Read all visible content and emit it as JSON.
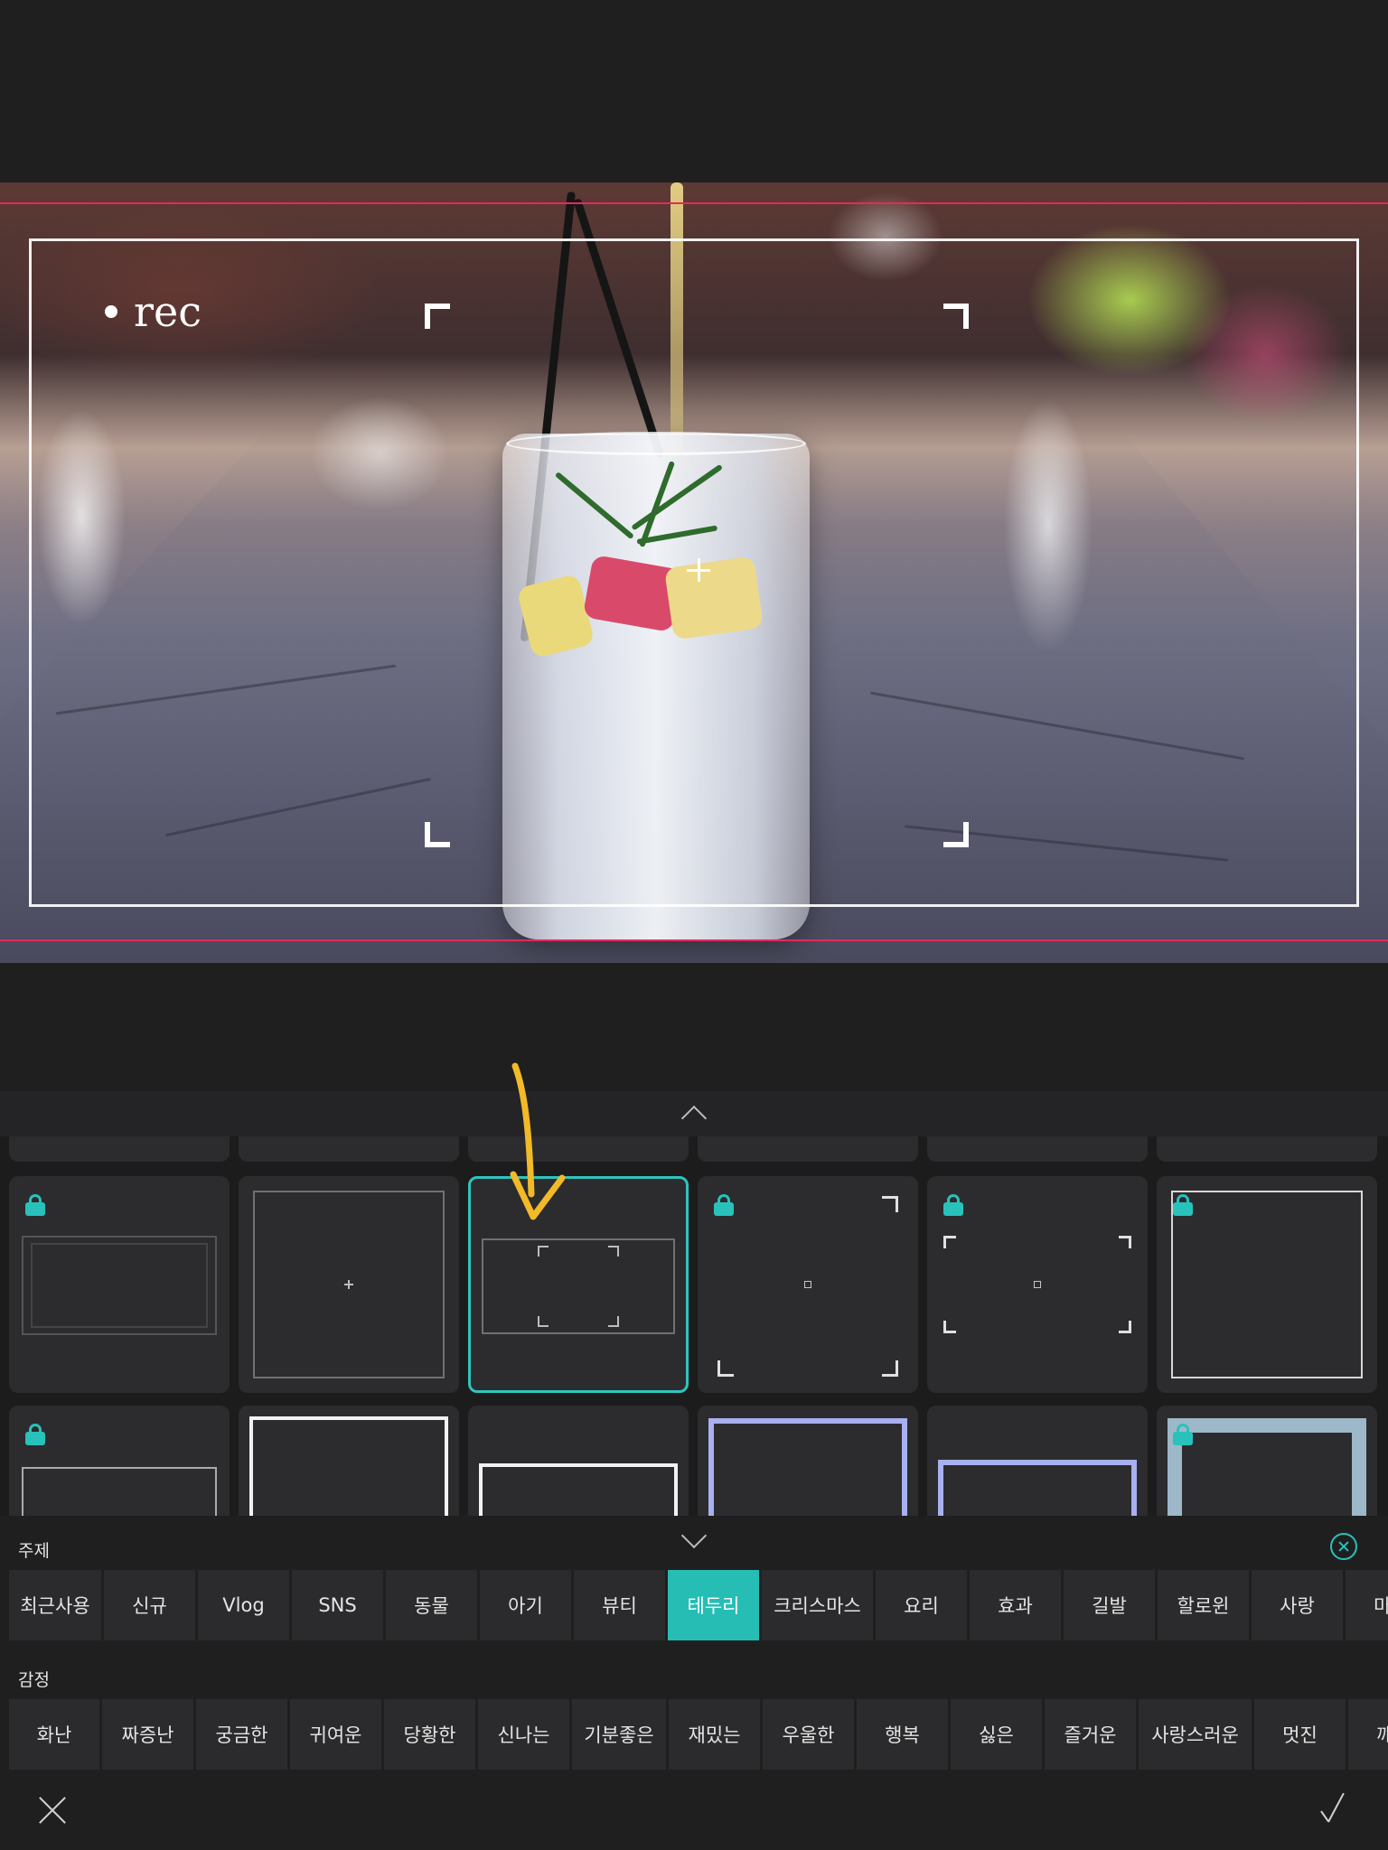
{
  "preview": {
    "overlay_text": "rec",
    "guide_color": "#e8285a"
  },
  "panel": {
    "accent_color": "#26bdb5",
    "selected_template_index": 8,
    "subject_label": "주제",
    "emotion_label": "감정",
    "subject_categories": [
      "최근사용",
      "신규",
      "Vlog",
      "SNS",
      "동물",
      "아기",
      "뷰티",
      "테두리",
      "크리스마스",
      "요리",
      "효과",
      "길발",
      "할로윈",
      "사랑",
      "마블"
    ],
    "active_subject": "테두리",
    "emotion_categories": [
      "화난",
      "짜증난",
      "궁금한",
      "귀여운",
      "당황한",
      "신나는",
      "기분좋은",
      "재밌는",
      "우울한",
      "행복",
      "싫은",
      "즐거운",
      "사랑스러운",
      "멋진",
      "깨끗"
    ]
  },
  "icons": {
    "expand": "chevron-up-icon",
    "collapse": "chevron-down-icon",
    "clear": "circle-close-icon",
    "lock": "lock-icon",
    "cancel": "close-icon",
    "confirm": "check-icon"
  }
}
